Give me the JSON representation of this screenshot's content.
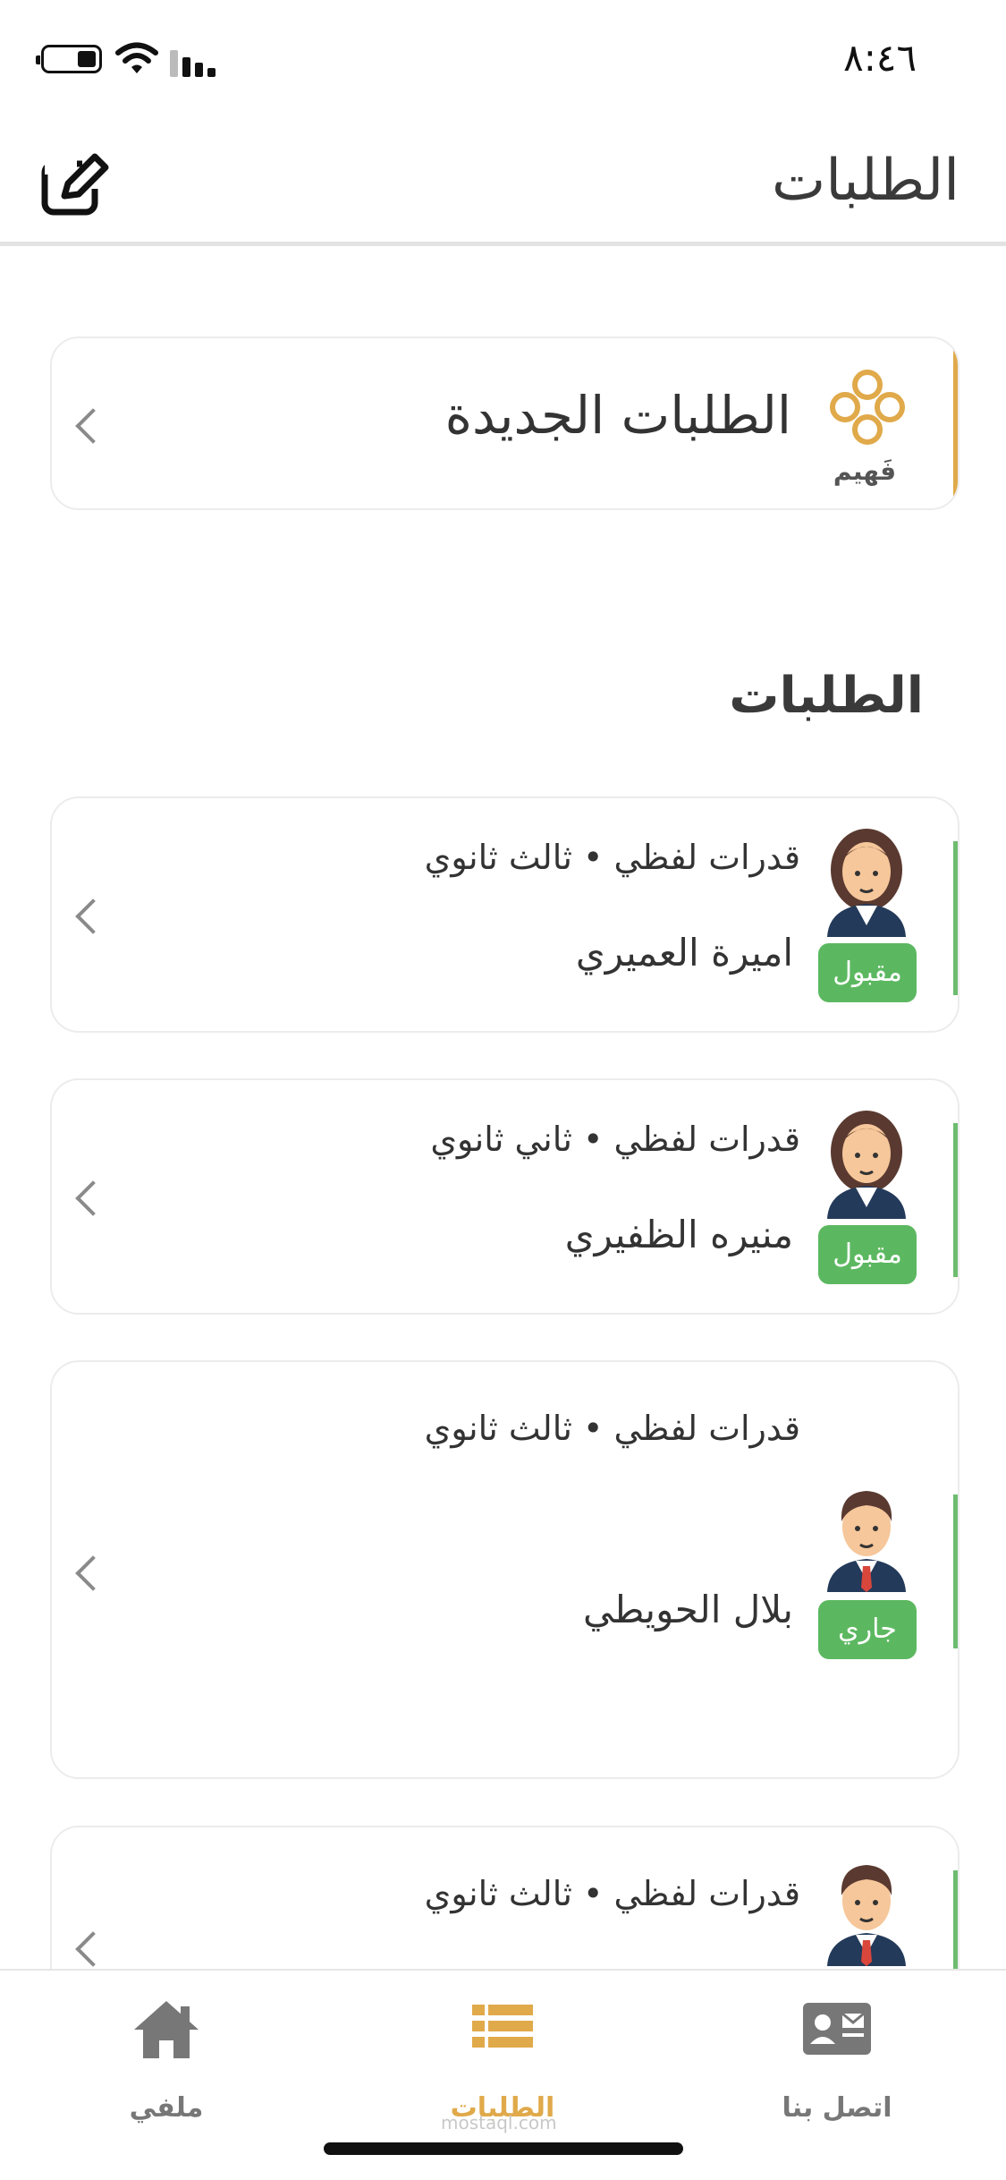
{
  "status_bar": {
    "time": "٨:٤٦"
  },
  "header": {
    "title": "الطلبات",
    "edit_icon": "edit-icon"
  },
  "new_orders": {
    "title": "الطلبات الجديدة",
    "logo_text": "فَهيم"
  },
  "section": {
    "title": "الطلبات"
  },
  "orders": [
    {
      "subject": "قدرات لفظي • ثالث ثانوي",
      "name": "اميرة العميري",
      "status": "مقبول",
      "avatar": "female-avatar-icon"
    },
    {
      "subject": "قدرات لفظي • ثاني ثانوي",
      "name": "منيره الظفيري",
      "status": "مقبول",
      "avatar": "female-avatar-icon"
    },
    {
      "subject": "قدرات لفظي • ثالث ثانوي",
      "name": "بلال الحويطي",
      "status": "جاري",
      "avatar": "male-avatar-icon"
    },
    {
      "subject": "قدرات لفظي • ثالث ثانوي",
      "name": "",
      "status": "",
      "avatar": "male-avatar-icon"
    }
  ],
  "tabs": [
    {
      "label": "ملفي",
      "icon": "home-icon"
    },
    {
      "label": "الطلبات",
      "icon": "list-icon",
      "active": true
    },
    {
      "label": "اتصل بنا",
      "icon": "contact-card-icon"
    }
  ],
  "watermark": "mostaql.com",
  "colors": {
    "accent": "#e0a94a",
    "success": "#5cb860",
    "text": "#333333"
  }
}
